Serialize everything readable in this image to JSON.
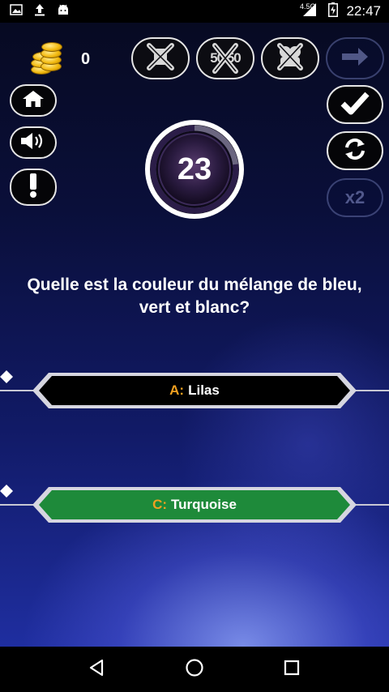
{
  "status_bar": {
    "time": "22:47",
    "network": "4.5G",
    "icons": [
      "image-icon",
      "upload-icon",
      "android-icon",
      "signal-icon",
      "battery-icon"
    ]
  },
  "header": {
    "coins_count": "0",
    "lifelines": [
      {
        "name": "lifeline-ask-audience",
        "icon": "crossed-out-icon",
        "enabled": true
      },
      {
        "name": "lifeline-fifty-fifty",
        "icon": "fifty-fifty-crossed-icon",
        "label": "50 50",
        "enabled": true
      },
      {
        "name": "lifeline-phone",
        "icon": "crossed-out-icon",
        "enabled": true
      },
      {
        "name": "lifeline-next",
        "icon": "arrow-right-icon",
        "enabled": false
      }
    ]
  },
  "left_buttons": [
    "home-icon",
    "sound-icon",
    "exclamation-icon"
  ],
  "right_buttons": {
    "confirm": "check-icon",
    "switch": "refresh-icon",
    "double_label": "x2"
  },
  "timer": {
    "seconds": "23",
    "remaining_fraction": 0.77
  },
  "question": {
    "text": "Quelle est la couleur du mélange de bleu, vert et blanc?"
  },
  "answers": [
    {
      "letter": "A:",
      "text": "Lilas",
      "color": "#000000"
    },
    {
      "letter": "C:",
      "text": "Turquoise",
      "color": "#1e8a3a"
    }
  ],
  "colors": {
    "answer_letter": "#f0a020",
    "background_top": "#070a22",
    "background_bottom": "#1f2ea0",
    "coin": "#f2b90f"
  },
  "nav_bar": {
    "icons": [
      "back-icon",
      "home-circle-icon",
      "recents-icon"
    ]
  }
}
